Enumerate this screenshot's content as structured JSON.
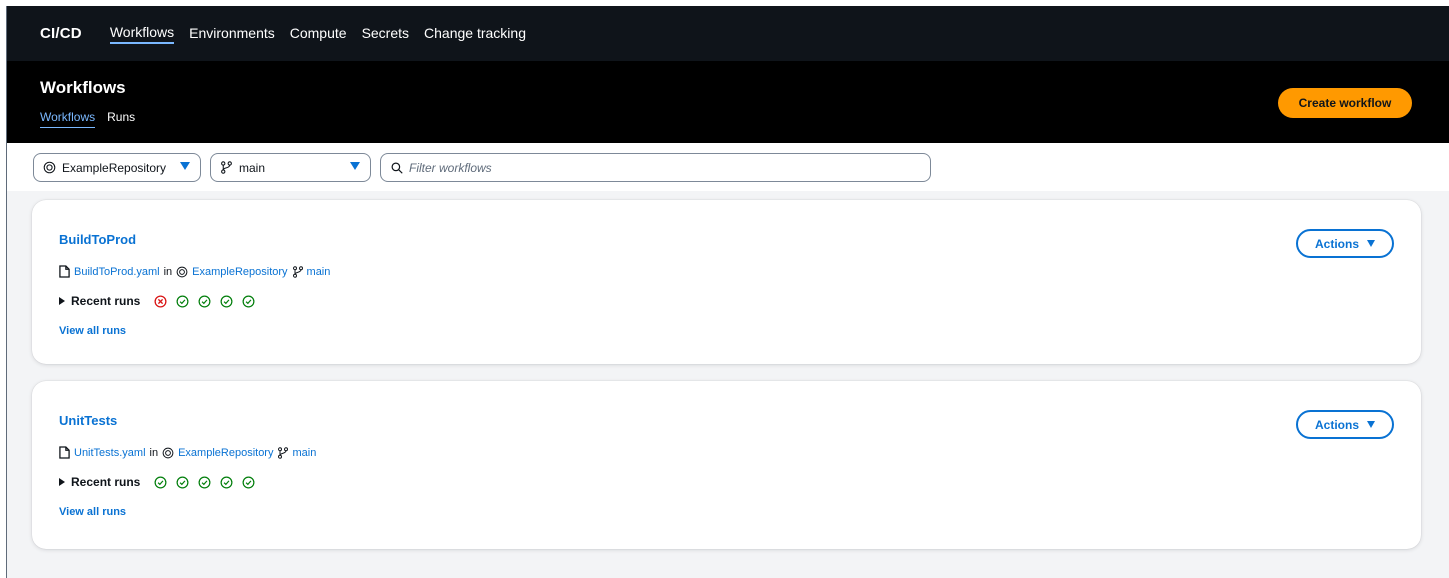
{
  "topnav": {
    "brand": "CI/CD",
    "links": [
      "Workflows",
      "Environments",
      "Compute",
      "Secrets",
      "Change tracking"
    ],
    "active": "Workflows"
  },
  "header": {
    "title": "Workflows",
    "tabs": [
      "Workflows",
      "Runs"
    ],
    "active_tab": "Workflows",
    "create_button": "Create workflow"
  },
  "filters": {
    "repository": "ExampleRepository",
    "branch": "main",
    "search_placeholder": "Filter workflows"
  },
  "workflows": [
    {
      "name": "BuildToProd",
      "file": "BuildToProd.yaml",
      "in_text": "in",
      "repository": "ExampleRepository",
      "branch": "main",
      "recent_runs_label": "Recent runs",
      "runs": [
        "failed",
        "succeeded",
        "succeeded",
        "succeeded",
        "succeeded"
      ],
      "view_all": "View all runs",
      "actions_label": "Actions"
    },
    {
      "name": "UnitTests",
      "file": "UnitTests.yaml",
      "in_text": "in",
      "repository": "ExampleRepository",
      "branch": "main",
      "recent_runs_label": "Recent runs",
      "runs": [
        "succeeded",
        "succeeded",
        "succeeded",
        "succeeded",
        "succeeded"
      ],
      "view_all": "View all runs",
      "actions_label": "Actions"
    }
  ],
  "colors": {
    "accent": "#0972d3",
    "primary_button": "#ff9900",
    "success": "#037f0c",
    "error": "#d91515",
    "nav_bg": "#0f141a"
  }
}
